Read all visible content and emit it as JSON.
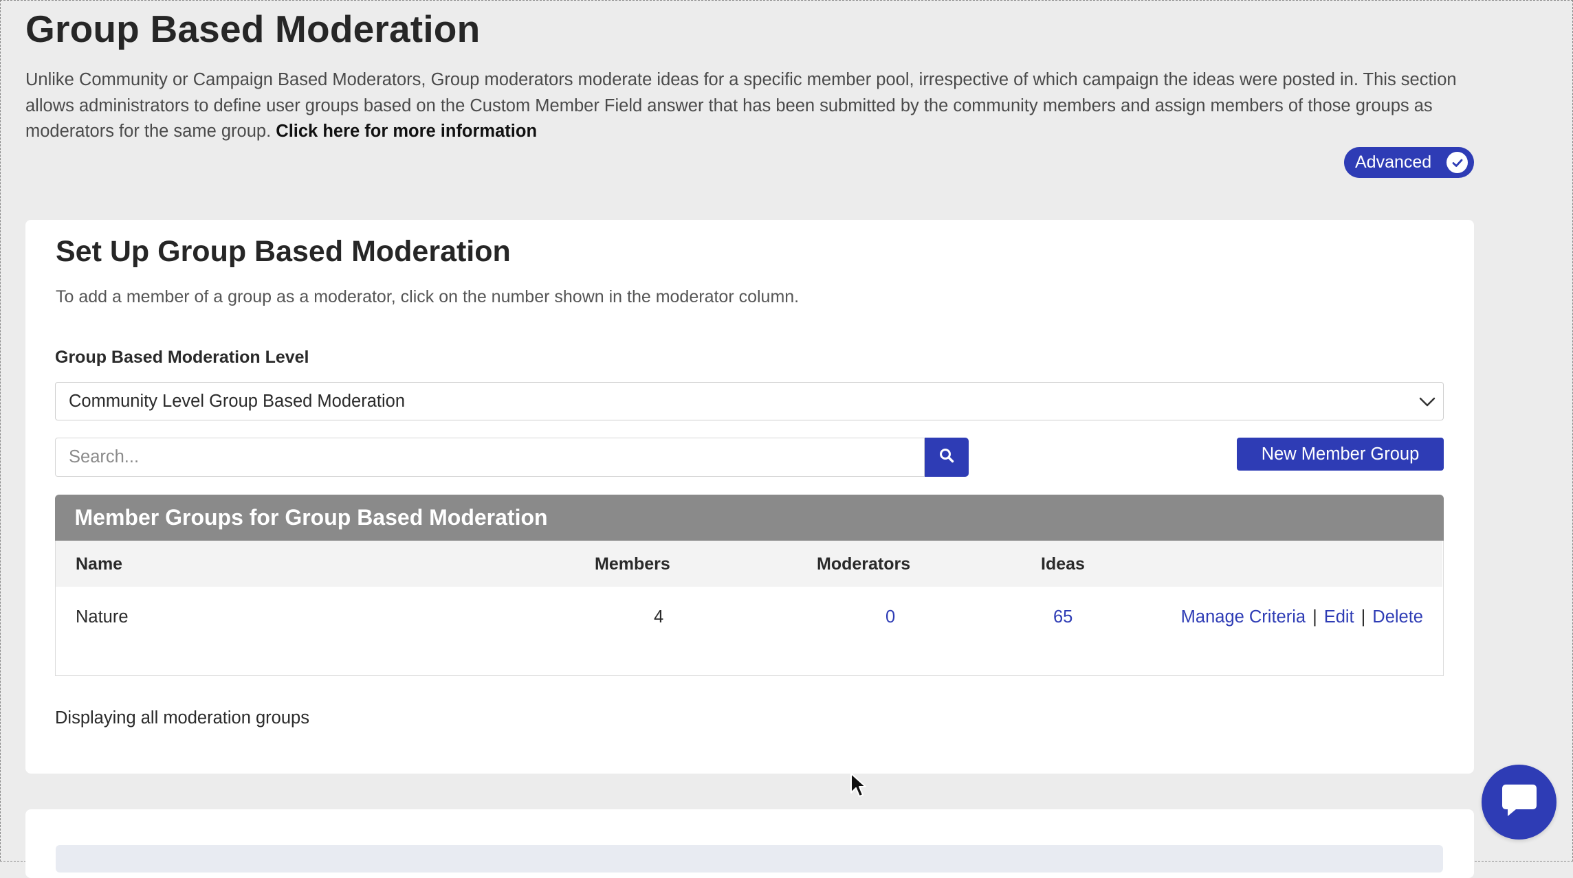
{
  "page": {
    "title": "Group Based Moderation",
    "intro": "Unlike Community or Campaign Based Moderators, Group moderators moderate ideas for a specific member pool, irrespective of which campaign the ideas were posted in. This section allows administrators to define user groups based on the Custom Member Field answer that has been submitted by the community members and assign members of those groups as moderators for the same group.",
    "more_info_link": "Click here for more information",
    "badge_label": "Advanced"
  },
  "setup": {
    "title": "Set Up Group Based Moderation",
    "subtitle": "To add a member of a group as a moderator, click on the number shown in the moderator column.",
    "level_label": "Group Based Moderation Level",
    "level_selected": "Community Level Group Based Moderation",
    "search_placeholder": "Search...",
    "new_group_label": "New Member Group"
  },
  "table": {
    "title": "Member Groups for Group Based Moderation",
    "columns": [
      "Name",
      "Members",
      "Moderators",
      "Ideas"
    ],
    "rows": [
      {
        "name": "Nature",
        "members": "4",
        "moderators": "0",
        "ideas": "65",
        "actions": [
          "Manage Criteria",
          "Edit",
          "Delete"
        ]
      }
    ],
    "footer": "Displaying all moderation groups"
  },
  "colors": {
    "accent": "#2e3cb5",
    "table_header": "#8a8a8a",
    "background": "#ececec"
  },
  "icons": {
    "badge": "check-circle-icon",
    "select": "chevron-down-icon",
    "search": "search-icon",
    "chat": "chat-bubble-icon"
  }
}
